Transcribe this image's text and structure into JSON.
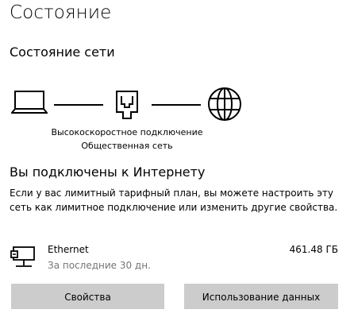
{
  "page": {
    "title": "Состояние"
  },
  "network_status": {
    "section_title": "Состояние сети",
    "network_name": "Высокоскоростное подключение",
    "network_profile": "Общественная сеть",
    "icons": [
      "laptop-icon",
      "ethernet-port-icon",
      "globe-icon"
    ]
  },
  "connection": {
    "heading": "Вы подключены к Интернету",
    "description": "Если у вас лимитный тарифный план, вы можете настроить эту сеть как лимитное подключение или изменить другие свойства."
  },
  "adapter": {
    "icon": "ethernet-adapter-icon",
    "name": "Ethernet",
    "period": "За последние 30 дн.",
    "usage": "461.48 ГБ"
  },
  "buttons": {
    "properties_label": "Свойства",
    "data_usage_label": "Использование данных"
  },
  "colors": {
    "button_bg": "#cccccc",
    "secondary_text": "#767676"
  }
}
